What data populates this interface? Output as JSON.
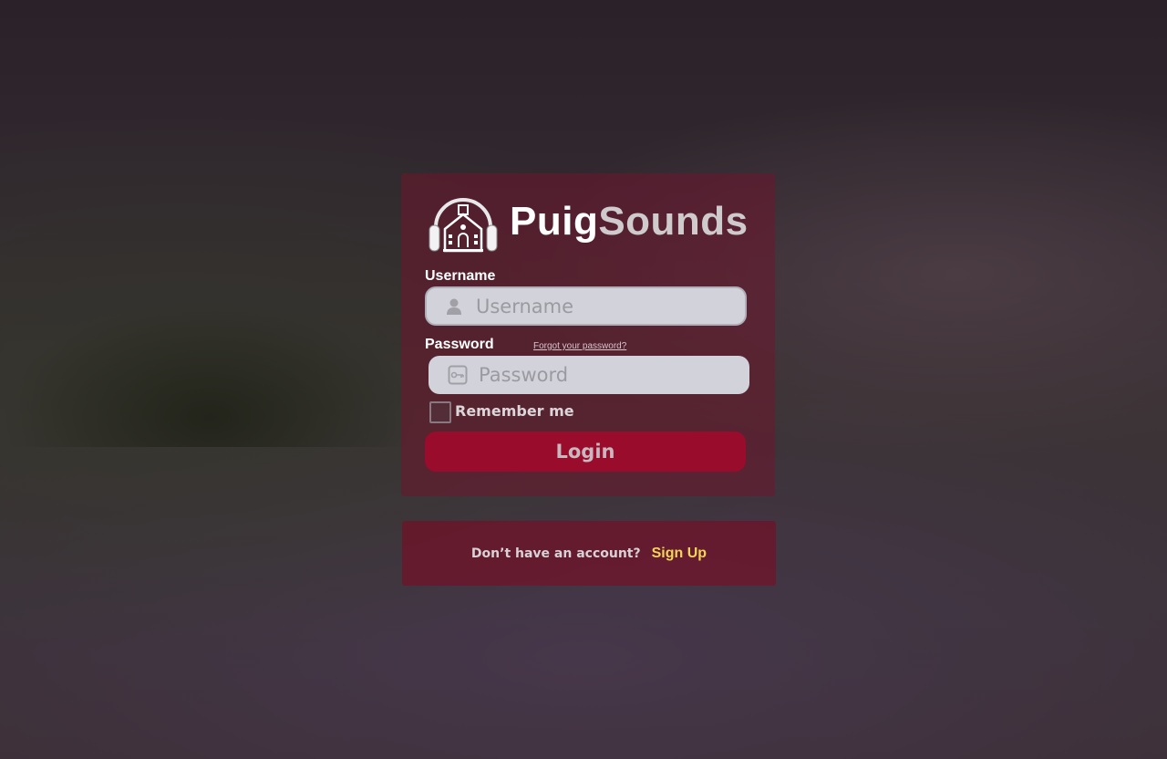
{
  "brand": {
    "name_part1": "Puig",
    "name_part2": "Sounds",
    "logo_icon": "headphones-schoolhouse-logo"
  },
  "form": {
    "username_label": "Username",
    "username_placeholder": "Username",
    "password_label": "Password",
    "password_placeholder": "Password",
    "forgot_link": "Forgot your password?",
    "remember_label": "Remember me",
    "login_button": "Login"
  },
  "signup": {
    "prompt": "Don’t have an account?",
    "link": "Sign Up"
  },
  "colors": {
    "accent": "#9a0c2c",
    "link": "#f2d45a",
    "input_bg": "#d2d2da"
  }
}
